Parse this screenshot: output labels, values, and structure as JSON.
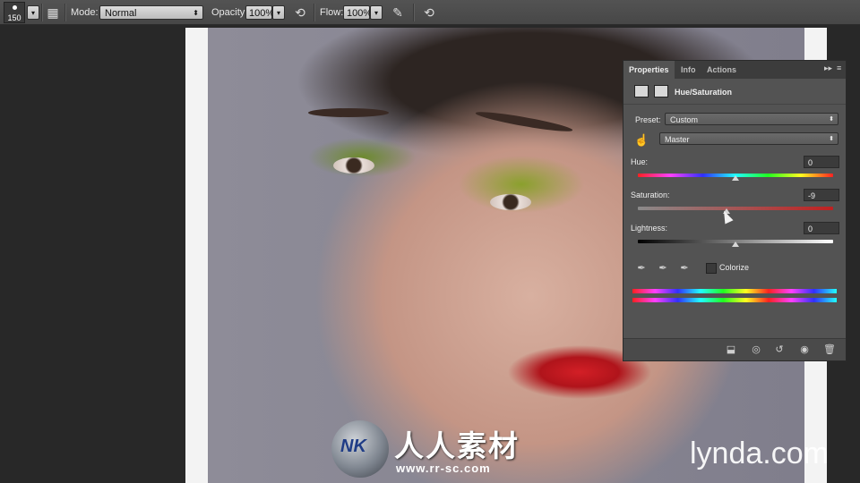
{
  "options_bar": {
    "brush_size": "150",
    "mode_label": "Mode:",
    "mode_value": "Normal",
    "opacity_label": "Opacity:",
    "opacity_value": "100%",
    "flow_label": "Flow:",
    "flow_value": "100%"
  },
  "panel": {
    "tabs": [
      "Properties",
      "Info",
      "Actions"
    ],
    "active_tab": "Properties",
    "title": "Hue/Saturation",
    "preset_label": "Preset:",
    "preset_value": "Custom",
    "channel_value": "Master",
    "hue": {
      "label": "Hue:",
      "value": "0",
      "position": 0.5
    },
    "saturation": {
      "label": "Saturation:",
      "value": "-9",
      "position": 0.455
    },
    "lightness": {
      "label": "Lightness:",
      "value": "0",
      "position": 0.5
    },
    "colorize_label": "Colorize",
    "colorize_checked": false
  },
  "watermark": {
    "badge": "NK",
    "chinese": "人人素材",
    "url": "www.rr-sc.com"
  },
  "lynda": "lynda.com",
  "colors": {
    "panel_bg": "#535353",
    "toolbar_bg": "#4d4d4d",
    "lip_red": "#c8161d",
    "eyeshadow_green": "#8aa02c"
  }
}
